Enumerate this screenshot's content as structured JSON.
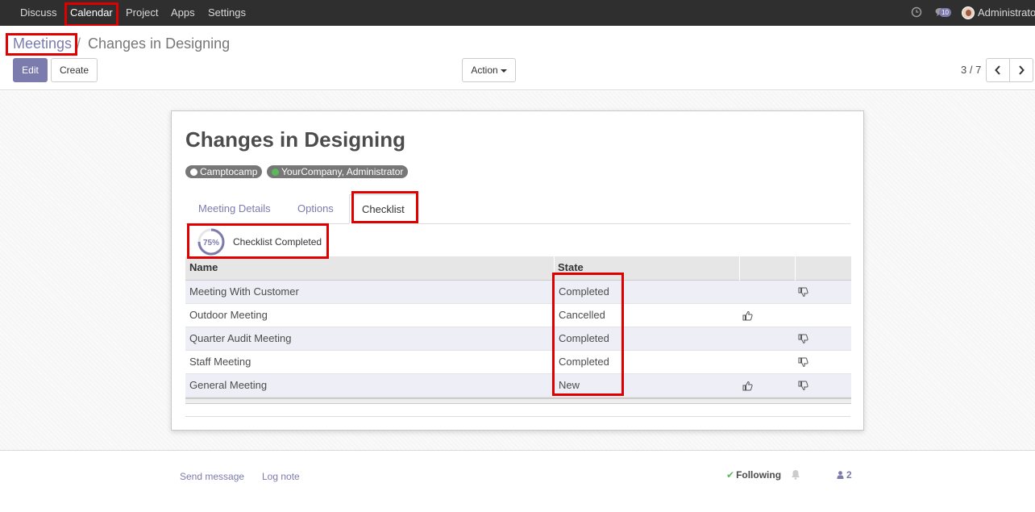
{
  "navbar": {
    "menus": [
      "Discuss",
      "Calendar",
      "Project",
      "Apps",
      "Settings"
    ],
    "active_menu": "Calendar",
    "message_count": "10",
    "user_name": "Administrator"
  },
  "breadcrumb": {
    "parent": "Meetings",
    "separator": "/",
    "current": "Changes in Designing"
  },
  "buttons": {
    "edit": "Edit",
    "create": "Create",
    "action": "Action"
  },
  "pager": {
    "value": "3 / 7"
  },
  "record": {
    "title": "Changes in Designing",
    "attendees": [
      {
        "name": "Camptocamp",
        "status_color": "#ffffff"
      },
      {
        "name": "YourCompany, Administrator",
        "status_color": "#5cb85c"
      }
    ]
  },
  "tabs": [
    "Meeting Details",
    "Options",
    "Checklist"
  ],
  "active_tab": "Checklist",
  "checklist": {
    "progress_percent": 75,
    "progress_text": "75%",
    "progress_label": "Checklist Completed",
    "columns": {
      "name": "Name",
      "state": "State"
    },
    "rows": [
      {
        "name": "Meeting With Customer",
        "state": "Completed",
        "thumbs_up": false,
        "thumbs_down": true
      },
      {
        "name": "Outdoor Meeting",
        "state": "Cancelled",
        "thumbs_up": true,
        "thumbs_down": false
      },
      {
        "name": "Quarter Audit Meeting",
        "state": "Completed",
        "thumbs_up": false,
        "thumbs_down": true
      },
      {
        "name": "Staff Meeting",
        "state": "Completed",
        "thumbs_up": false,
        "thumbs_down": true
      },
      {
        "name": "General Meeting",
        "state": "New",
        "thumbs_up": true,
        "thumbs_down": true
      }
    ]
  },
  "chatter": {
    "send_message": "Send message",
    "log_note": "Log note",
    "following": "Following",
    "followers_count": "2"
  },
  "colors": {
    "brand": "#7c7bad",
    "navbar": "#2f2f2f",
    "highlight": "#e00000"
  }
}
